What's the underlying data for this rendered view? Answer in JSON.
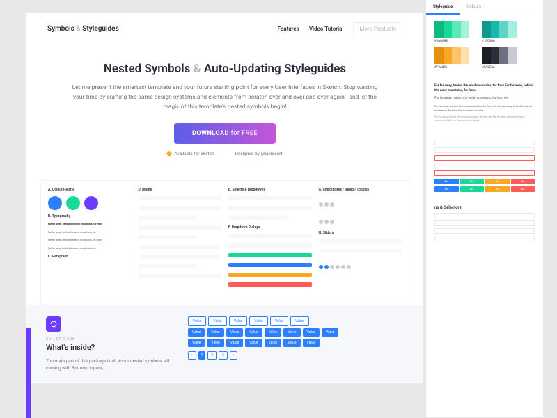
{
  "nav": {
    "logo_a": "Symbols",
    "logo_amp": "&",
    "logo_b": "Styleguides",
    "features": "Features",
    "tutorial": "Video Tutorial",
    "more": "More Products"
  },
  "hero": {
    "title_a": "Nested Symbols",
    "title_amp": "&",
    "title_b": "Auto-Updating Styleguides",
    "body": "Let me present the smartest template and your future starting point for every User Interfaces in Sketch. Stop wasting your time by crafting the same design systems and elements from scratch over and over and over again - and let the magic of this template's nested symbols begin!",
    "cta_a": "DOWNLOAD",
    "cta_b": "for FREE",
    "meta_sketch": "Available for Sketch",
    "meta_design": "Designed by @janlosert"
  },
  "preview": {
    "tab_a": "Symbols & Styleguides",
    "tab_b": "Styleguide",
    "colour_label": "A. Colour Palette",
    "typo_label": "B. Typography",
    "typo_line1": "Far far away, behind the word mountains, far from",
    "typo_line2": "Far far away, behind the word mountains, far",
    "para_label": "C. Paragraph",
    "inputs_label": "D. Inputs",
    "select_label": "E. Selects & Dropdowns",
    "dropdown_label": "F. Dropdown Dialogs",
    "check_label": "G. Checkboxes / Radio / Toggles",
    "sliders_label": "H. Sliders"
  },
  "section2": {
    "eyebrow": "So let's see",
    "title": "What's inside?",
    "body": "The main part of this package is all about nested symbols. All coming with Buttons, Inputs,",
    "btn": "Value"
  },
  "right": {
    "tab1": "Styleguide",
    "tab2": "Colours",
    "sw1": "#1AD898",
    "sw2": "#F9A826",
    "sw3": "#2A2E3A",
    "txt1": "Far far away, behind the word mountains, far from Far far away, behind the word mountains, far from",
    "txt2": "Far far away, behind the word mountains, far from the",
    "txt3": "Far far away, behind the word mountains, far from the Far far away, behind the word mountains, far from the countries Vokalia",
    "btn": "Btn",
    "selectors": "ns & Selectors"
  }
}
